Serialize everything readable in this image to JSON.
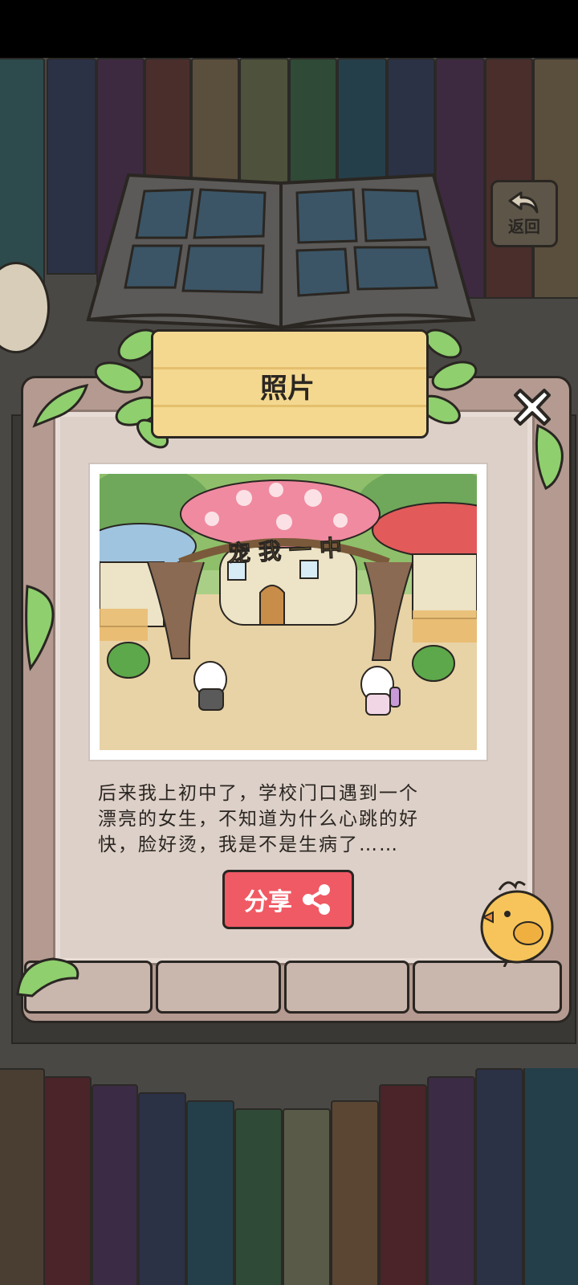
{
  "dialog": {
    "title": "照片",
    "story": "后来我上初中了，学校门口遇到一个\n漂亮的女生，不知道为什么心跳的好\n快，脸好烫，我是不是生病了……",
    "share_label": "分享"
  },
  "header": {
    "back_label": "返回"
  },
  "photo": {
    "sign_text": "宠我一中"
  },
  "colors": {
    "share_button": "#f05a64",
    "title_board": "#f5d88f",
    "panel_inner": "#ddd0c8",
    "background": "#4a4845"
  }
}
